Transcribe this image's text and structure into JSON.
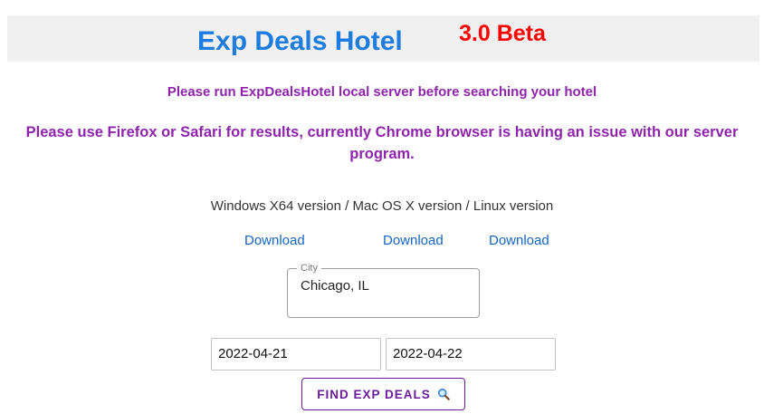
{
  "header": {
    "title": "Exp Deals Hotel",
    "version": "3.0 Beta"
  },
  "notices": {
    "server": "Please run ExpDealsHotel local server before searching your hotel",
    "browser": "Please use Firefox or Safari for results, currently Chrome browser is having an issue with our server program."
  },
  "downloads": {
    "versions_line": "Windows X64 version / Mac OS X version / Linux version",
    "links": [
      {
        "label": "Download"
      },
      {
        "label": "Download"
      },
      {
        "label": "Download"
      }
    ]
  },
  "search": {
    "city": {
      "label": "City",
      "value": "Chicago, IL"
    },
    "checkin": {
      "value": "2022-04-21"
    },
    "checkout": {
      "value": "2022-04-22"
    },
    "button_label": "FIND EXP DEALS",
    "button_icon": "search-icon"
  },
  "colors": {
    "title": "#1e7be0",
    "version": "#ff0000",
    "notice": "#8e24aa",
    "link": "#1565c0",
    "button": "#6a1b9a"
  }
}
